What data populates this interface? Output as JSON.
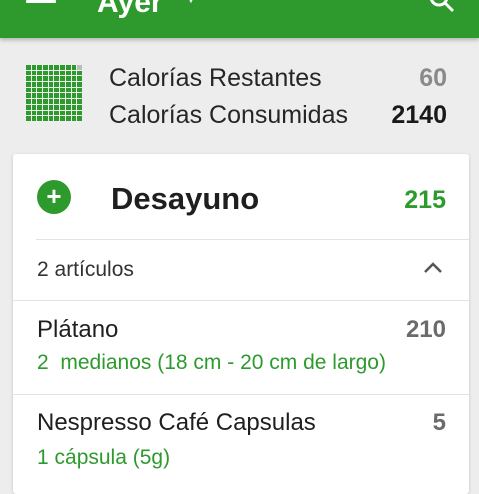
{
  "topbar": {
    "title": "Ayer",
    "menu_icon": "menu-icon",
    "search_icon": "search-icon"
  },
  "summary": {
    "remaining_label": "Calorías Restantes",
    "remaining_value": "60",
    "consumed_label": "Calorías Consumidas",
    "consumed_value": "2140"
  },
  "meal": {
    "title": "Desayuno",
    "calories": "215",
    "items_count": "2 artículos",
    "items": [
      {
        "name": "Plátano",
        "calories": "210",
        "serving": "2  medianos (18 cm - 20 cm de largo)"
      },
      {
        "name": "Nespresso Café Capsulas",
        "calories": "5",
        "serving": "1 cápsula (5g)"
      }
    ]
  },
  "colors": {
    "brand_green": "#2e9a2e",
    "background": "#ededed"
  }
}
